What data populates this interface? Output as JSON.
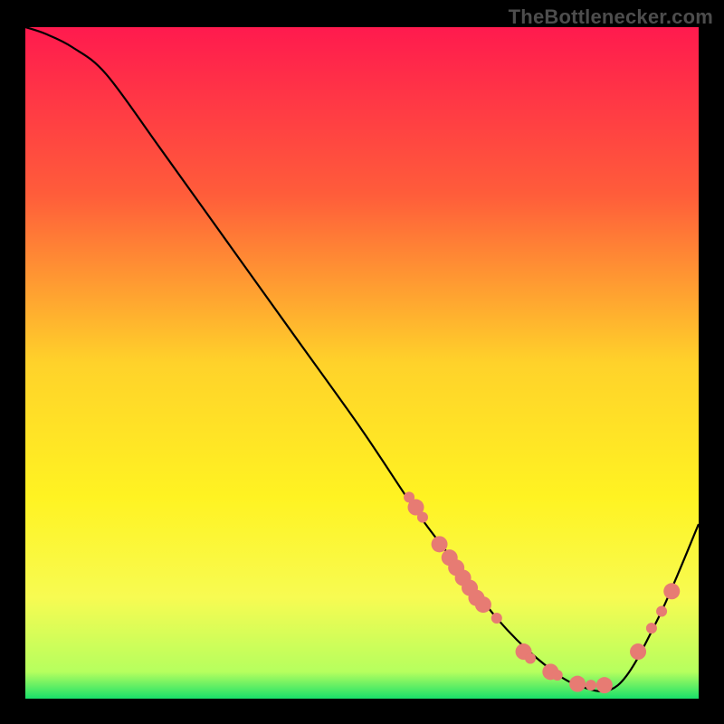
{
  "attribution": "TheBottlenecker.com",
  "chart_data": {
    "type": "line",
    "title": "",
    "xlabel": "",
    "ylabel": "",
    "xlim": [
      0,
      100
    ],
    "ylim": [
      0,
      100
    ],
    "grid": false,
    "legend": false,
    "gradient_stops": [
      {
        "offset": 0,
        "color": "#ff1a4e"
      },
      {
        "offset": 25,
        "color": "#ff5d3a"
      },
      {
        "offset": 50,
        "color": "#ffd22a"
      },
      {
        "offset": 70,
        "color": "#fff322"
      },
      {
        "offset": 85,
        "color": "#f7fb52"
      },
      {
        "offset": 96,
        "color": "#b6ff5e"
      },
      {
        "offset": 100,
        "color": "#19e06a"
      }
    ],
    "series": [
      {
        "name": "bottleneck-curve",
        "color": "#000000",
        "x": [
          0,
          3,
          7,
          12,
          20,
          30,
          40,
          50,
          58,
          64,
          70,
          76,
          82,
          88,
          94,
          100
        ],
        "values": [
          100,
          99,
          97,
          93,
          82,
          68,
          54,
          40,
          28,
          20,
          12,
          6,
          2,
          2,
          12,
          26
        ]
      }
    ],
    "markers": [
      {
        "name": "cluster-a",
        "color": "#e77b73",
        "radius_small": 6,
        "radius_large": 9,
        "points": [
          {
            "x": 57,
            "y": 30,
            "size": "small"
          },
          {
            "x": 58,
            "y": 28.5,
            "size": "large"
          },
          {
            "x": 59,
            "y": 27,
            "size": "small"
          },
          {
            "x": 61.5,
            "y": 23,
            "size": "large"
          },
          {
            "x": 63,
            "y": 21,
            "size": "large"
          },
          {
            "x": 64,
            "y": 19.5,
            "size": "large"
          },
          {
            "x": 65,
            "y": 18,
            "size": "large"
          },
          {
            "x": 66,
            "y": 16.5,
            "size": "large"
          },
          {
            "x": 67,
            "y": 15,
            "size": "large"
          },
          {
            "x": 68,
            "y": 14,
            "size": "large"
          },
          {
            "x": 70,
            "y": 12,
            "size": "small"
          },
          {
            "x": 74,
            "y": 7,
            "size": "large"
          },
          {
            "x": 75,
            "y": 6,
            "size": "small"
          },
          {
            "x": 78,
            "y": 4,
            "size": "large"
          },
          {
            "x": 79,
            "y": 3.5,
            "size": "small"
          },
          {
            "x": 82,
            "y": 2.2,
            "size": "large"
          },
          {
            "x": 84,
            "y": 2,
            "size": "small"
          },
          {
            "x": 86,
            "y": 2,
            "size": "large"
          },
          {
            "x": 91,
            "y": 7,
            "size": "large"
          },
          {
            "x": 93,
            "y": 10.5,
            "size": "small"
          },
          {
            "x": 94.5,
            "y": 13,
            "size": "small"
          },
          {
            "x": 96,
            "y": 16,
            "size": "large"
          }
        ]
      }
    ]
  }
}
